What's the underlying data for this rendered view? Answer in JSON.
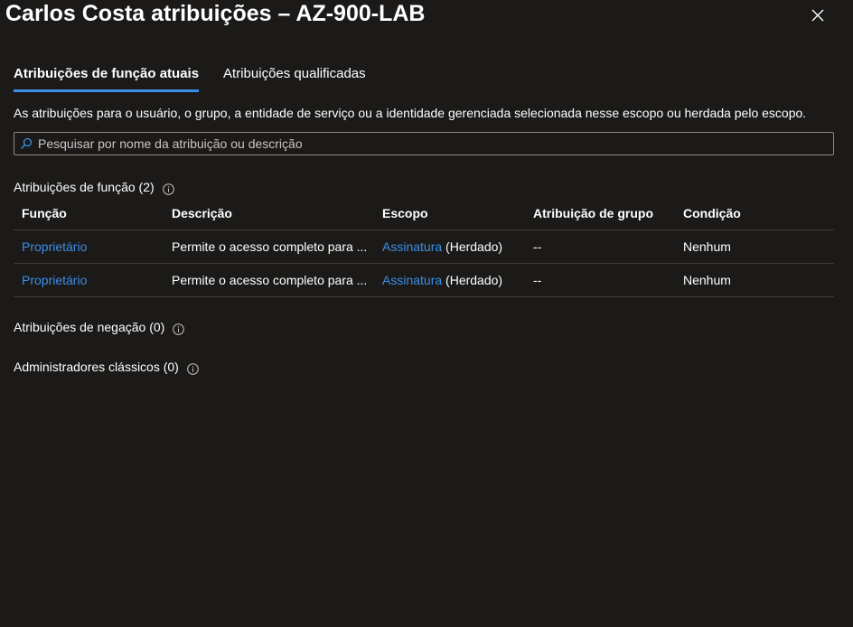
{
  "title": "Carlos Costa atribuições – AZ-900-LAB",
  "tabs": [
    {
      "label": "Atribuições de função atuais",
      "active": true
    },
    {
      "label": "Atribuições qualificadas",
      "active": false
    }
  ],
  "description": "As atribuições para o usuário, o grupo, a entidade de serviço ou a identidade gerenciada selecionada nesse escopo ou herdada pelo escopo.",
  "search": {
    "placeholder": "Pesquisar por nome da atribuição ou descrição",
    "value": ""
  },
  "role_assignments": {
    "label": "Atribuições de função (2)",
    "columns": [
      "Função",
      "Descrição",
      "Escopo",
      "Atribuição de grupo",
      "Condição"
    ],
    "rows": [
      {
        "role": "Proprietário",
        "description": "Permite o acesso completo para ...",
        "scope_link": "Assinatura",
        "scope_suffix": " (Herdado)",
        "group_assignment": "--",
        "condition": "Nenhum"
      },
      {
        "role": "Proprietário",
        "description": "Permite o acesso completo para ...",
        "scope_link": "Assinatura",
        "scope_suffix": " (Herdado)",
        "group_assignment": "--",
        "condition": "Nenhum"
      }
    ]
  },
  "deny_assignments": {
    "label": "Atribuições de negação (0)"
  },
  "classic_admins": {
    "label": "Administradores clássicos (0)"
  },
  "colors": {
    "background": "#1b1a19",
    "accent": "#3b8ee9",
    "link": "#3b8ee9",
    "divider": "#3b3a39"
  }
}
